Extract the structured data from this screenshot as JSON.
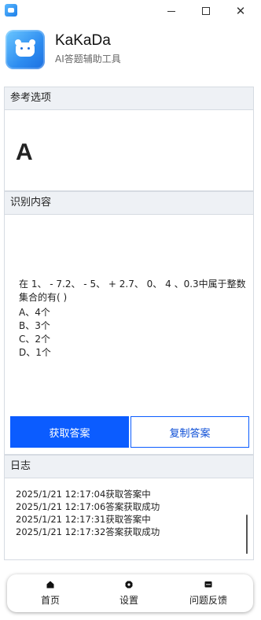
{
  "window": {
    "close_glyph": "✕"
  },
  "app": {
    "name": "KaKaDa",
    "subtitle": "AI答题辅助工具",
    "logo_icon": "bear-logo-icon"
  },
  "reference": {
    "heading": "参考选项",
    "answer": "A"
  },
  "recognized": {
    "heading": "识别内容",
    "question": "在 1、 - 7.2、 - 5、 + 2.7、 0、 4 、0.3中属于整数集合的有(     )",
    "options": [
      "A、4个",
      "B、3个",
      "C、2个",
      "D、1个"
    ]
  },
  "actions": {
    "get_answer": "获取答案",
    "copy_answer": "复制答案",
    "primary_color": "#0b5cff"
  },
  "log": {
    "heading": "日志",
    "entries": [
      "2025/1/21 12:17:04获取答案中",
      "2025/1/21 12:17:06答案获取成功",
      "2025/1/21 12:17:31获取答案中",
      "2025/1/21 12:17:32答案获取成功"
    ]
  },
  "nav": {
    "items": [
      {
        "label": "首页",
        "icon": "home-icon"
      },
      {
        "label": "设置",
        "icon": "gear-icon"
      },
      {
        "label": "问题反馈",
        "icon": "chat-icon"
      }
    ]
  }
}
